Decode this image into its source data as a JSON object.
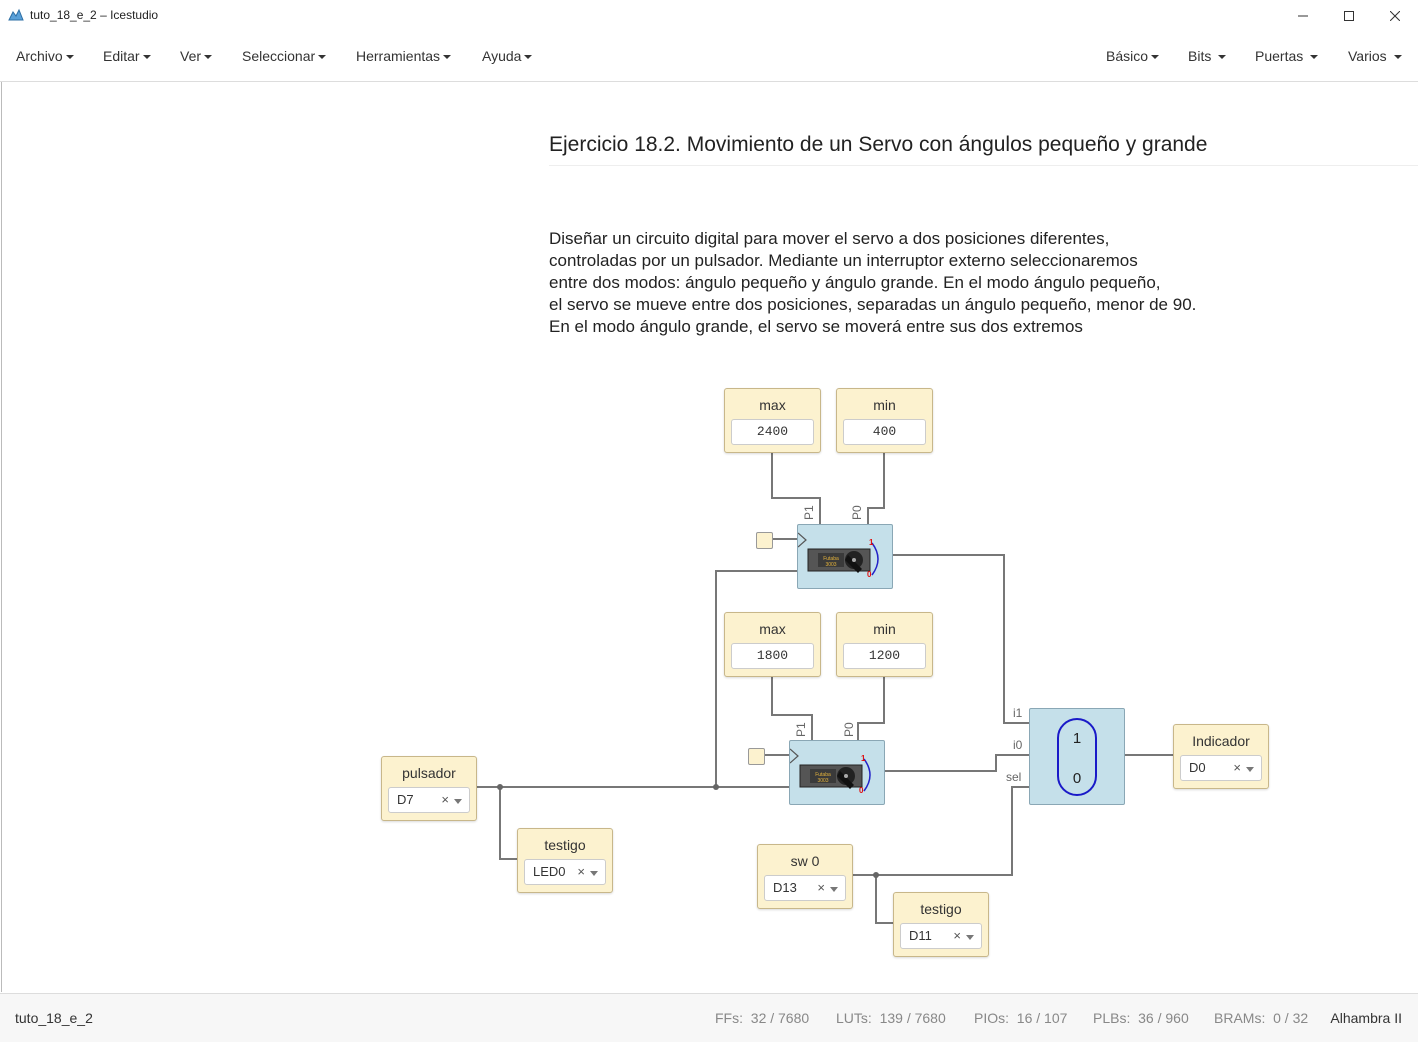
{
  "window": {
    "title": "tuto_18_e_2 – Icestudio",
    "icon": "icestudio-logo-icon",
    "controls": [
      "minimize-icon",
      "maximize-icon",
      "close-icon"
    ]
  },
  "menubar": {
    "left": [
      {
        "label": "Archivo"
      },
      {
        "label": "Editar"
      },
      {
        "label": "Ver"
      },
      {
        "label": "Seleccionar"
      },
      {
        "label": "Herramientas"
      },
      {
        "label": "Ayuda"
      }
    ],
    "right": [
      {
        "label": "Básico"
      },
      {
        "label": "Bits"
      },
      {
        "label": "Puertas"
      },
      {
        "label": "Varios"
      }
    ]
  },
  "info": {
    "title": "Ejercicio 18.2. Movimiento de un Servo con ángulos pequeño y grande",
    "body": "Diseñar un circuito digital para mover el servo a dos posiciones diferentes,\ncontroladas por un pulsador. Mediante un interruptor externo seleccionaremos\nentre dos modos: ángulo pequeño y ángulo grande. En el modo ángulo pequeño,\nel servo se mueve entre dos posiciones, separadas un ángulo pequeño, menor de 90.\nEn el modo ángulo grande, el servo se moverá entre sus dos extremos"
  },
  "circuit": {
    "constants": {
      "top_max": {
        "label": "max",
        "value": "2400"
      },
      "top_min": {
        "label": "min",
        "value": "400"
      },
      "bottom_max": {
        "label": "max",
        "value": "1800"
      },
      "bottom_min": {
        "label": "min",
        "value": "1200"
      }
    },
    "servo_ports": {
      "p1": "P1",
      "p0": "P0"
    },
    "servo_image": {
      "brand": "Futaba",
      "model": "3003",
      "one": "1",
      "zero": "0"
    },
    "mux": {
      "i1": "i1",
      "i0": "i0",
      "sel": "sel",
      "top": "1",
      "bottom": "0"
    },
    "io": {
      "pulsador": {
        "label": "pulsador",
        "pin": "D7"
      },
      "testigo1": {
        "label": "testigo",
        "pin": "LED0"
      },
      "sw0": {
        "label": "sw 0",
        "pin": "D13"
      },
      "testigo2": {
        "label": "testigo",
        "pin": "D11"
      },
      "indicador": {
        "label": "Indicador",
        "pin": "D0"
      }
    },
    "clear_symbol": "×",
    "colors": {
      "wire": "#777777",
      "io_block": "#fcf2cf",
      "code_block": "#c5e0ea",
      "mux_ring": "#1a1ac8"
    }
  },
  "status": {
    "file": "tuto_18_e_2",
    "stats": [
      {
        "name": "FFs:",
        "value": "32 / 7680"
      },
      {
        "name": "LUTs:",
        "value": "139 / 7680"
      },
      {
        "name": "PIOs:",
        "value": "16 / 107"
      },
      {
        "name": "PLBs:",
        "value": "36 / 960"
      },
      {
        "name": "BRAMs:",
        "value": "0 / 32"
      }
    ],
    "board": "Alhambra II"
  }
}
